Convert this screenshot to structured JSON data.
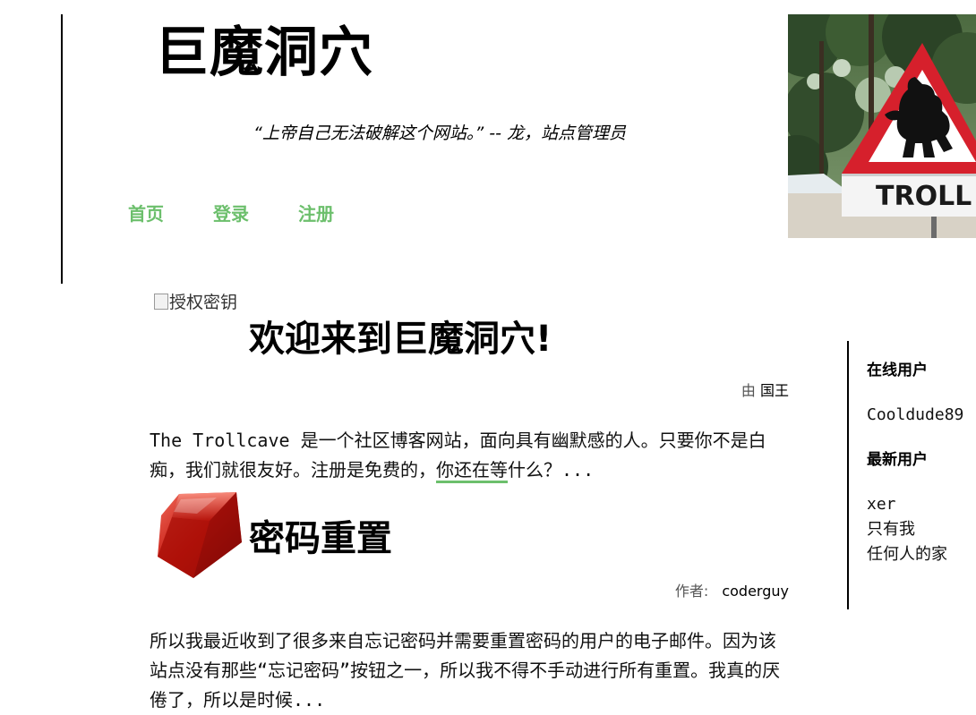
{
  "header": {
    "site_title": "巨魔洞穴",
    "tagline": "“上帝自己无法破解这个网站。” -- 龙，站点管理员",
    "nav": [
      {
        "label": "首页"
      },
      {
        "label": "登录"
      },
      {
        "label": "注册"
      }
    ],
    "image_text": "TROLL"
  },
  "posts": [
    {
      "image_alt": "授权密钥",
      "title": "欢迎来到巨魔洞穴!",
      "byline_label": "由",
      "author": "国王",
      "excerpt_before": "The Trollcave 是一个社区博客网站，面向具有幽默感的人。只要你不是白痴，我们就很友好。注册是免费的，",
      "excerpt_highlight": "你还在等",
      "excerpt_after": "什么？..."
    },
    {
      "icon": "ruby-icon",
      "title": "密码重置",
      "byline_label": "作者:",
      "author": "coderguy",
      "excerpt": "所以我最近收到了很多来自忘记密码并需要重置密码的用户的电子邮件。因为该站点没有那些“忘记密码”按钮之一，所以我不得不手动进行所有重置。我真的厌倦了，所以是时候..."
    }
  ],
  "sidebar": {
    "online_heading": "在线用户",
    "online_users": [
      "Cooldude89"
    ],
    "newest_heading": "最新用户",
    "newest_users": [
      "xer",
      "只有我",
      "任何人的家"
    ]
  },
  "colors": {
    "nav_link": "#6cbf6c",
    "highlight_underline": "#6cbf6c",
    "sign_red": "#d6202c"
  }
}
